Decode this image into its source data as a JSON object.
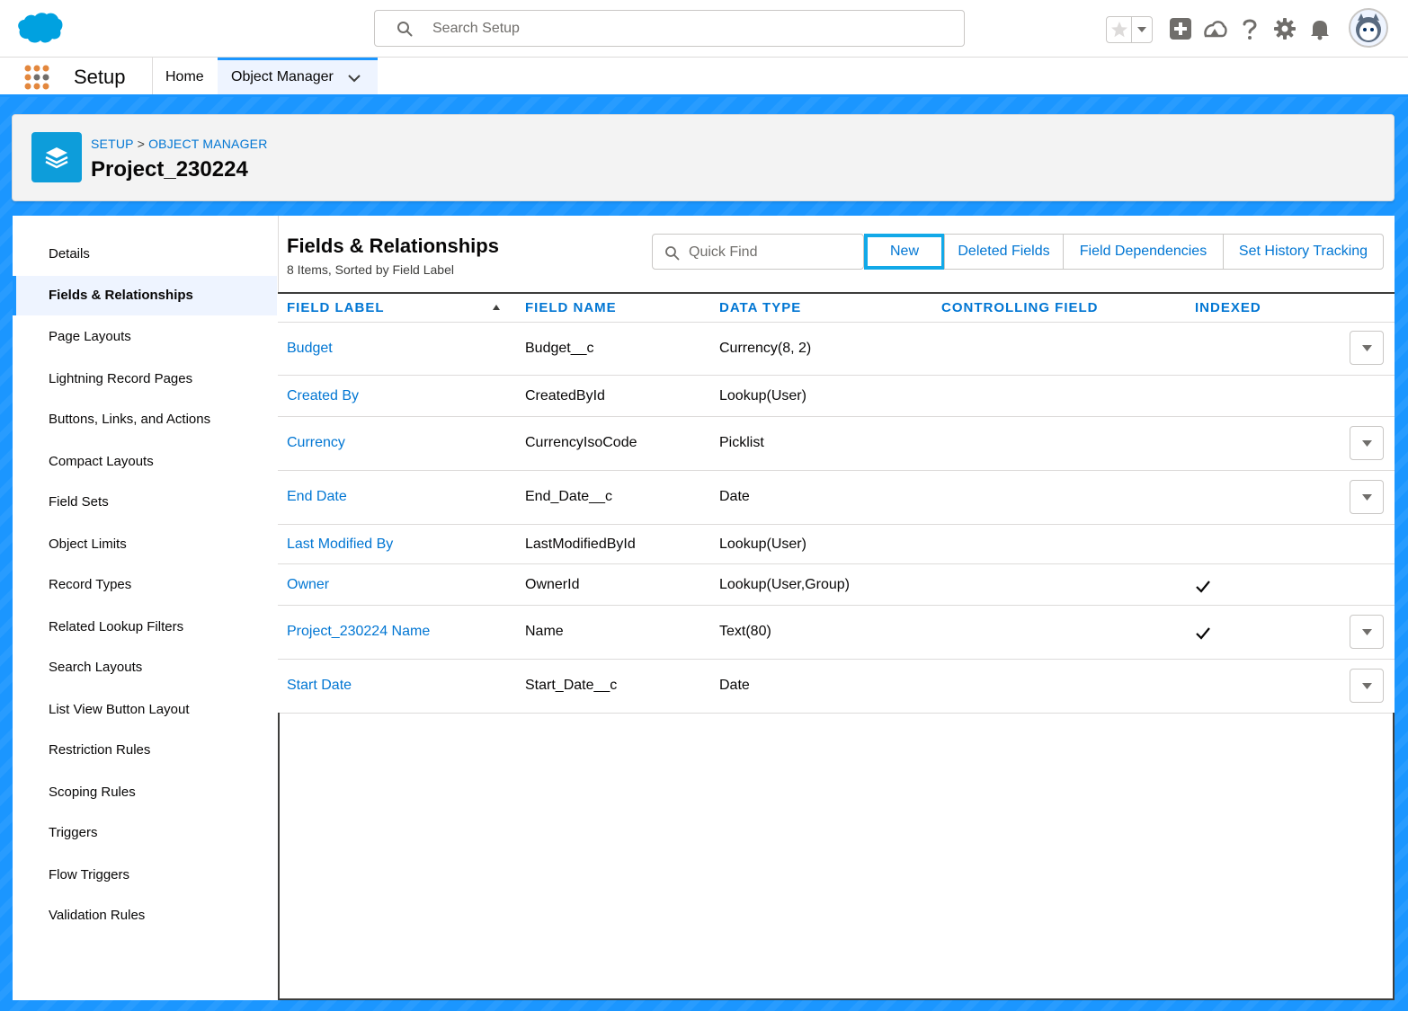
{
  "colors": {
    "brand": "#1b96ff",
    "link": "#0176d3",
    "highlight_outline": "#12a9e8",
    "object_icon": "#0d9dda"
  },
  "global_header": {
    "search_placeholder": "Search Setup",
    "icons": [
      "salesforce-cloud-logo",
      "search-icon",
      "star-icon",
      "chevron-down-icon",
      "add-icon",
      "trailhead-icon",
      "help-icon",
      "gear-icon",
      "bell-icon",
      "avatar"
    ]
  },
  "context_nav": {
    "app_name": "Setup",
    "tabs": [
      {
        "label": "Home"
      },
      {
        "label": "Object Manager",
        "active": true
      }
    ]
  },
  "page_header": {
    "breadcrumb": [
      "SETUP",
      "OBJECT MANAGER"
    ],
    "breadcrumb_separator": ">",
    "title": "Project_230224"
  },
  "sidebar": {
    "items": [
      {
        "label": "Details"
      },
      {
        "label": "Fields & Relationships",
        "active": true
      },
      {
        "label": "Page Layouts"
      },
      {
        "label": "Lightning Record Pages"
      },
      {
        "label": "Buttons, Links, and Actions"
      },
      {
        "label": "Compact Layouts"
      },
      {
        "label": "Field Sets"
      },
      {
        "label": "Object Limits"
      },
      {
        "label": "Record Types"
      },
      {
        "label": "Related Lookup Filters"
      },
      {
        "label": "Search Layouts"
      },
      {
        "label": "List View Button Layout"
      },
      {
        "label": "Restriction Rules"
      },
      {
        "label": "Scoping Rules"
      },
      {
        "label": "Triggers"
      },
      {
        "label": "Flow Triggers"
      },
      {
        "label": "Validation Rules"
      }
    ]
  },
  "main": {
    "title": "Fields & Relationships",
    "subtitle": "8 Items, Sorted by Field Label",
    "quick_find_placeholder": "Quick Find",
    "buttons": {
      "new": "New",
      "deleted": "Deleted Fields",
      "dependencies": "Field Dependencies",
      "history": "Set History Tracking"
    },
    "columns": [
      "FIELD LABEL",
      "FIELD NAME",
      "DATA TYPE",
      "CONTROLLING FIELD",
      "INDEXED"
    ],
    "rows": [
      {
        "label": "Budget",
        "name": "Budget__c",
        "type": "Currency(8, 2)",
        "controlling": "",
        "indexed": false,
        "has_action": true
      },
      {
        "label": "Created By",
        "name": "CreatedById",
        "type": "Lookup(User)",
        "controlling": "",
        "indexed": false,
        "has_action": false
      },
      {
        "label": "Currency",
        "name": "CurrencyIsoCode",
        "type": "Picklist",
        "controlling": "",
        "indexed": false,
        "has_action": true
      },
      {
        "label": "End Date",
        "name": "End_Date__c",
        "type": "Date",
        "controlling": "",
        "indexed": false,
        "has_action": true
      },
      {
        "label": "Last Modified By",
        "name": "LastModifiedById",
        "type": "Lookup(User)",
        "controlling": "",
        "indexed": false,
        "has_action": false
      },
      {
        "label": "Owner",
        "name": "OwnerId",
        "type": "Lookup(User,Group)",
        "controlling": "",
        "indexed": true,
        "has_action": false
      },
      {
        "label": "Project_230224 Name",
        "name": "Name",
        "type": "Text(80)",
        "controlling": "",
        "indexed": true,
        "has_action": true
      },
      {
        "label": "Start Date",
        "name": "Start_Date__c",
        "type": "Date",
        "controlling": "",
        "indexed": false,
        "has_action": true
      }
    ]
  }
}
